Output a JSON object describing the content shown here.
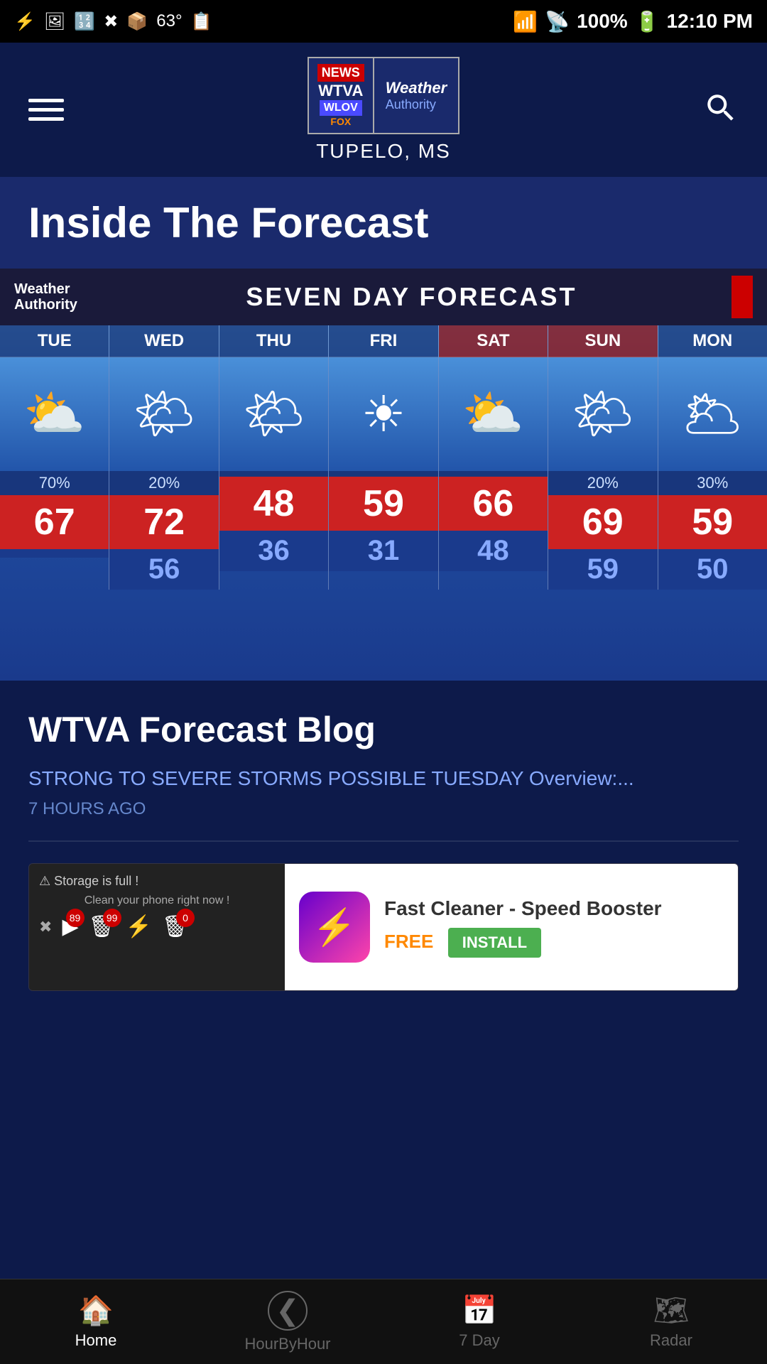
{
  "statusBar": {
    "temperature": "63°",
    "battery": "100%",
    "time": "12:10 PM"
  },
  "header": {
    "menuLabel": "menu",
    "logoWTVA": "WTVA",
    "logoNEWS": "NEWS",
    "logoWLOV": "WLOV",
    "logoFOX": "FOX",
    "logoWeather": "Weather",
    "logoAuthority": "Authority",
    "city": "TUPELO, MS"
  },
  "sectionTitle": "Inside The Forecast",
  "forecast": {
    "title": "SEVEN DAY FORECAST",
    "waLabel": "Weather\nAuthority",
    "days": [
      {
        "name": "TUE",
        "weekend": false,
        "icon": "⛅",
        "precip": "70%",
        "high": "67",
        "low": ""
      },
      {
        "name": "WED",
        "weekend": false,
        "icon": "🌤",
        "precip": "20%",
        "high": "72",
        "low": "56"
      },
      {
        "name": "THU",
        "weekend": false,
        "icon": "🌤",
        "precip": "",
        "high": "48",
        "low": "36"
      },
      {
        "name": "FRI",
        "weekend": false,
        "icon": "☀",
        "precip": "",
        "high": "59",
        "low": "31"
      },
      {
        "name": "SAT",
        "weekend": true,
        "icon": "⛅",
        "precip": "",
        "high": "66",
        "low": "48"
      },
      {
        "name": "SUN",
        "weekend": true,
        "icon": "🌤",
        "precip": "20%",
        "high": "69",
        "low": "59"
      },
      {
        "name": "MON",
        "weekend": false,
        "icon": "🌥",
        "precip": "30%",
        "high": "59",
        "low": "50"
      }
    ]
  },
  "blog": {
    "title": "WTVA Forecast Blog",
    "headline": "STRONG TO SEVERE STORMS POSSIBLE TUESDAY Overview:...",
    "timeAgo": "7 HOURS AGO"
  },
  "ad": {
    "storageWarning": "⚠ Storage is full !",
    "cleanText": "Clean your phone right now !",
    "appName": "Fast Cleaner - Speed Booster",
    "freeLabel": "FREE",
    "installLabel": "INSTALL",
    "icon": "⚡"
  },
  "bottomNav": {
    "items": [
      {
        "id": "home",
        "label": "Home",
        "icon": "🏠",
        "active": true
      },
      {
        "id": "hourbyhour",
        "label": "HourByHour",
        "icon": "⊲",
        "active": false
      },
      {
        "id": "7day",
        "label": "7 Day",
        "icon": "📅",
        "active": false
      },
      {
        "id": "radar",
        "label": "Radar",
        "icon": "🗺",
        "active": false
      }
    ]
  }
}
